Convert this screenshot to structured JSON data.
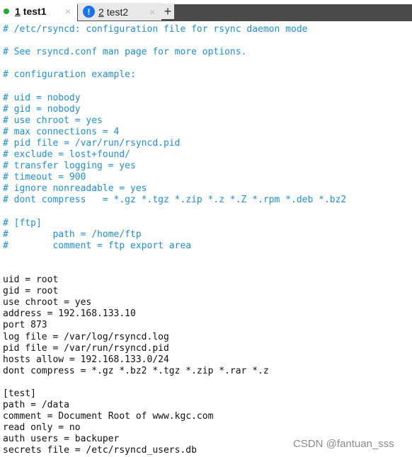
{
  "tabs": [
    {
      "number": "1",
      "name": "test1",
      "status": "connected",
      "close": "×"
    },
    {
      "number": "2",
      "name": "test2",
      "status": "warning",
      "close": "×"
    }
  ],
  "add_tab": "+",
  "icons": {
    "tab1_status": "green-dot-icon",
    "tab2_status": "warning-icon",
    "warning_glyph": "!"
  },
  "colors": {
    "comment": "#1f8fd6",
    "code": "#111111",
    "status_green": "#1faa3a",
    "warning_blue": "#1a73e8"
  },
  "editor": {
    "lines": [
      {
        "text": "# /etc/rsyncd: configuration file for rsync daemon mode",
        "type": "comment"
      },
      {
        "text": "",
        "type": "code"
      },
      {
        "text": "# See rsyncd.conf man page for more options.",
        "type": "comment"
      },
      {
        "text": "",
        "type": "code"
      },
      {
        "text": "# configuration example:",
        "type": "comment"
      },
      {
        "text": "",
        "type": "code"
      },
      {
        "text": "# uid = nobody",
        "type": "comment"
      },
      {
        "text": "# gid = nobody",
        "type": "comment"
      },
      {
        "text": "# use chroot = yes",
        "type": "comment"
      },
      {
        "text": "# max connections = 4",
        "type": "comment"
      },
      {
        "text": "# pid file = /var/run/rsyncd.pid",
        "type": "comment"
      },
      {
        "text": "# exclude = lost+found/",
        "type": "comment"
      },
      {
        "text": "# transfer logging = yes",
        "type": "comment"
      },
      {
        "text": "# timeout = 900",
        "type": "comment"
      },
      {
        "text": "# ignore nonreadable = yes",
        "type": "comment"
      },
      {
        "text": "# dont compress   = *.gz *.tgz *.zip *.z *.Z *.rpm *.deb *.bz2",
        "type": "comment"
      },
      {
        "text": "",
        "type": "code"
      },
      {
        "text": "# [ftp]",
        "type": "comment"
      },
      {
        "text": "#        path = /home/ftp",
        "type": "comment"
      },
      {
        "text": "#        comment = ftp export area",
        "type": "comment"
      },
      {
        "text": "",
        "type": "code"
      },
      {
        "text": "",
        "type": "code"
      },
      {
        "text": "uid = root",
        "type": "code"
      },
      {
        "text": "gid = root",
        "type": "code"
      },
      {
        "text": "use chroot = yes",
        "type": "code"
      },
      {
        "text": "address = 192.168.133.10",
        "type": "code"
      },
      {
        "text": "port 873",
        "type": "code"
      },
      {
        "text": "log file = /var/log/rsyncd.log",
        "type": "code"
      },
      {
        "text": "pid file = /var/run/rsyncd.pid",
        "type": "code"
      },
      {
        "text": "hosts allow = 192.168.133.0/24",
        "type": "code"
      },
      {
        "text": "dont compress = *.gz *.bz2 *.tgz *.zip *.rar *.z",
        "type": "code"
      },
      {
        "text": "",
        "type": "code"
      },
      {
        "text": "[test]",
        "type": "code"
      },
      {
        "text": "path = /data",
        "type": "code"
      },
      {
        "text": "comment = Document Root of www.kgc.com",
        "type": "code"
      },
      {
        "text": "read only = no",
        "type": "code"
      },
      {
        "text": "auth users = backuper",
        "type": "code"
      },
      {
        "text": "secrets file = /etc/rsyncd_users.db",
        "type": "code"
      }
    ]
  },
  "watermark": "CSDN @fantuan_sss"
}
